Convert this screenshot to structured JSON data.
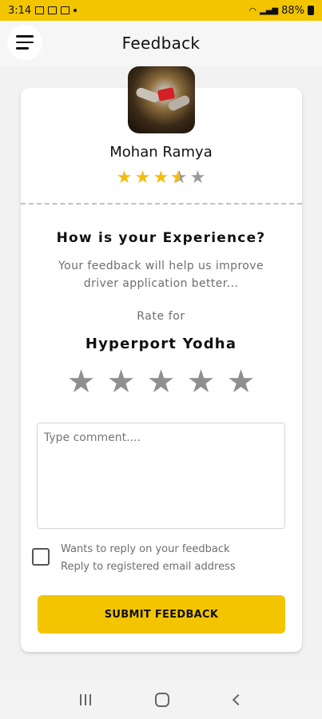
{
  "status_bar": {
    "time": "3:14",
    "battery": "88%"
  },
  "app_bar": {
    "title": "Feedback"
  },
  "driver": {
    "name": "Mohan Ramya",
    "rating_out_of_5": 3.5
  },
  "feedback": {
    "question": "How is your Experience?",
    "subtext_line1": "Your feedback will help us improve",
    "subtext_line2": "driver application better...",
    "rate_for_label": "Rate for",
    "company": "Hyperport Yodha",
    "rating_stars_total": 5,
    "comment_placeholder": "Type comment....",
    "comment_value": "",
    "checkbox_line1": "Wants to reply on your feedback",
    "checkbox_line2": "Reply to registered email address",
    "checkbox_checked": false,
    "submit_label": "SUBMIT FEEDBACK"
  },
  "colors": {
    "accent": "#f3c500",
    "star_filled": "#f3bd10",
    "star_empty": "#8f8f8f"
  }
}
